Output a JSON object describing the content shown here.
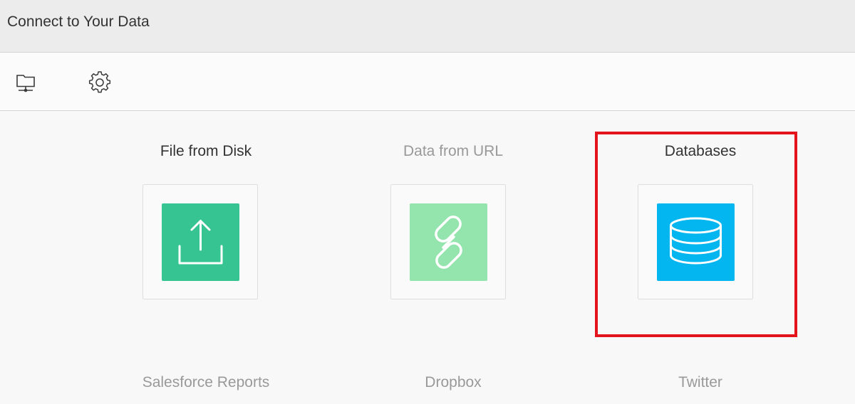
{
  "header": {
    "title": "Connect to Your Data"
  },
  "toolbar": {
    "buttons": [
      {
        "icon": "network-folder-icon"
      },
      {
        "icon": "gear-icon"
      }
    ]
  },
  "sources": [
    {
      "label": "File from Disk",
      "icon": "upload-icon",
      "color": "#35c492",
      "state": "enabled"
    },
    {
      "label": "Data from URL",
      "icon": "link-icon",
      "color": "#93e4ad",
      "state": "disabled"
    },
    {
      "label": "Databases",
      "icon": "database-icon",
      "color": "#04b6ef",
      "state": "enabled",
      "highlighted": true
    },
    {
      "label": "Salesforce Reports",
      "state": "disabled"
    },
    {
      "label": "Dropbox",
      "state": "disabled"
    },
    {
      "label": "Twitter",
      "state": "disabled"
    }
  ],
  "colors": {
    "highlight": "#e3141c",
    "enabled_text": "#333333",
    "disabled_text": "#999999"
  }
}
